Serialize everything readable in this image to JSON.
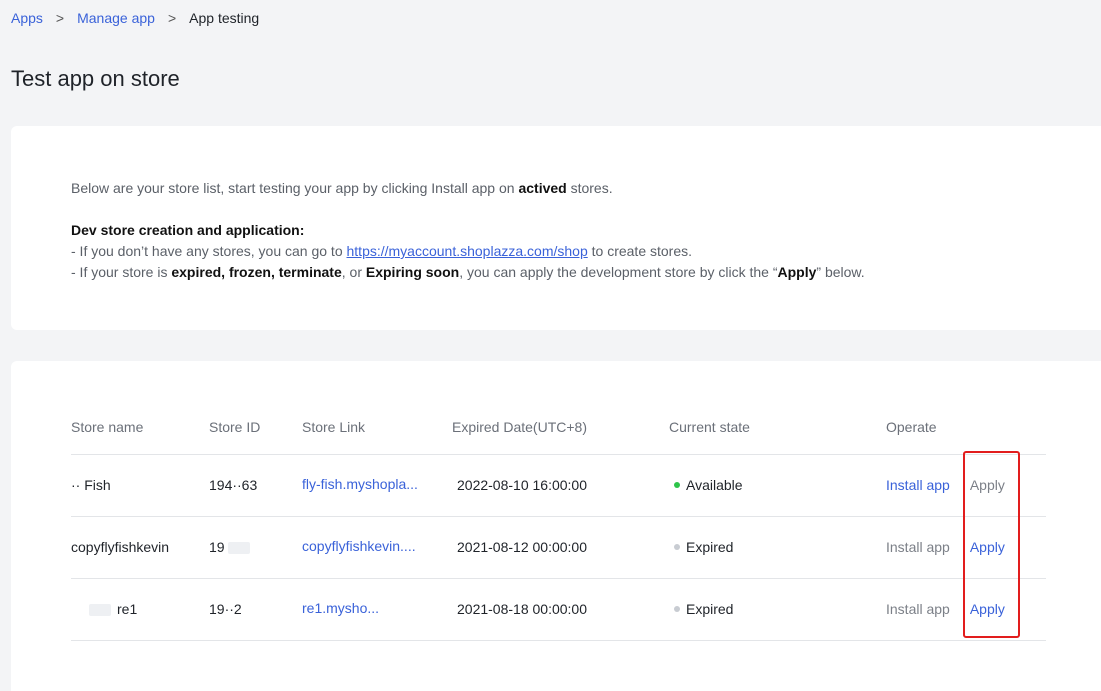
{
  "breadcrumb": {
    "items": [
      "Apps",
      "Manage app"
    ],
    "separator": ">",
    "current": "App testing"
  },
  "page_title": "Test app on store",
  "info": {
    "line1_prefix": "Below are your store list, start testing your app by clicking Install app on ",
    "line1_bold": "actived",
    "line1_suffix": " stores.",
    "heading": "Dev store creation and application:",
    "line2_prefix": "- If you don’t have any stores, you can go to ",
    "line2_link": "https://myaccount.shoplazza.com/shop",
    "line2_suffix": " to create stores.",
    "line3_prefix": "- If your store is ",
    "line3_bold1": "expired, frozen, terminate",
    "line3_mid1": ", or ",
    "line3_bold2": "Expiring soon",
    "line3_mid2": ", you can apply the development store by click the “",
    "line3_bold3": "Apply",
    "line3_suffix": "” below."
  },
  "table": {
    "columns": [
      "Store name",
      "Store ID",
      "Store Link",
      "Expired Date(UTC+8)",
      "Current state",
      "Operate"
    ],
    "rows": [
      {
        "name": "·· Fish",
        "id": "194··63",
        "link": "fly-fish.myshopla...",
        "date": "2022-08-10 16:00:00",
        "state": "Available",
        "install": "Install app",
        "apply": "Apply"
      },
      {
        "name": "copyflyfishkevin",
        "id": "19",
        "link": "copyflyfishkevin....",
        "date": "2021-08-12 00:00:00",
        "state": "Expired",
        "install": "Install app",
        "apply": "Apply"
      },
      {
        "name": "re1",
        "id": "19··2",
        "link": "re1.mysho...",
        "date": "2021-08-18 00:00:00",
        "state": "Expired",
        "install": "Install app",
        "apply": "Apply"
      }
    ]
  },
  "colors": {
    "accent": "#3a62d9",
    "available_dot": "#2ec44a",
    "expired_dot": "#c8ccd2",
    "highlight_border": "#e21d1d",
    "disabled_text": "#7c8088"
  }
}
